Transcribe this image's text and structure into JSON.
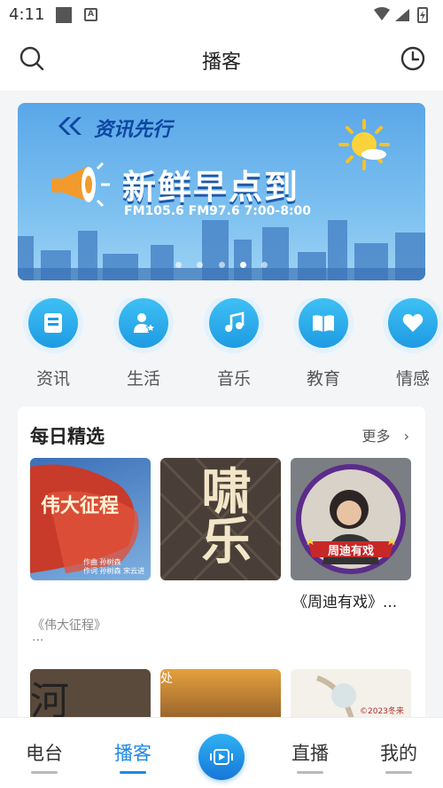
{
  "status_bar": {
    "time": "4:11"
  },
  "header": {
    "title": "播客"
  },
  "banner": {
    "brand": "资讯先行",
    "headline": "新鲜早点到",
    "frequency": "FM105.6  FM97.6  7:00-8:00",
    "active_slide": 3,
    "slide_count": 5
  },
  "categories": [
    {
      "label": "资讯",
      "icon": "news-icon"
    },
    {
      "label": "生活",
      "icon": "life-icon"
    },
    {
      "label": "音乐",
      "icon": "music-icon"
    },
    {
      "label": "教育",
      "icon": "book-icon"
    },
    {
      "label": "情感",
      "icon": "heart-icon"
    }
  ],
  "daily": {
    "title": "每日精选",
    "more": "更多",
    "items": [
      {
        "art_text": "伟大征程",
        "credit1": "作曲 孙树森",
        "credit2": "作词 孙树森 宋云进",
        "caption": "",
        "subcaption": "《伟大征程》",
        "ellipsis": "..."
      },
      {
        "art_text": "啸乐",
        "caption": "",
        "subcaption": ""
      },
      {
        "art_text": "周迪有戏",
        "badge": "FM1074 AM900",
        "caption": "《周迪有戏》...",
        "subcaption": ""
      }
    ],
    "row2": [
      {
        "art_text": "河"
      },
      {
        "art_text": "处"
      },
      {
        "art_text": "©2023冬来君"
      }
    ]
  },
  "nav": {
    "items": [
      {
        "label": "电台"
      },
      {
        "label": "播客"
      },
      {
        "label": "直播"
      },
      {
        "label": "我的"
      }
    ],
    "active": "播客"
  },
  "colors": {
    "accent": "#1e88e5",
    "banner_sky": "#5aa7e8",
    "icon_blue": "#1e9be3"
  }
}
